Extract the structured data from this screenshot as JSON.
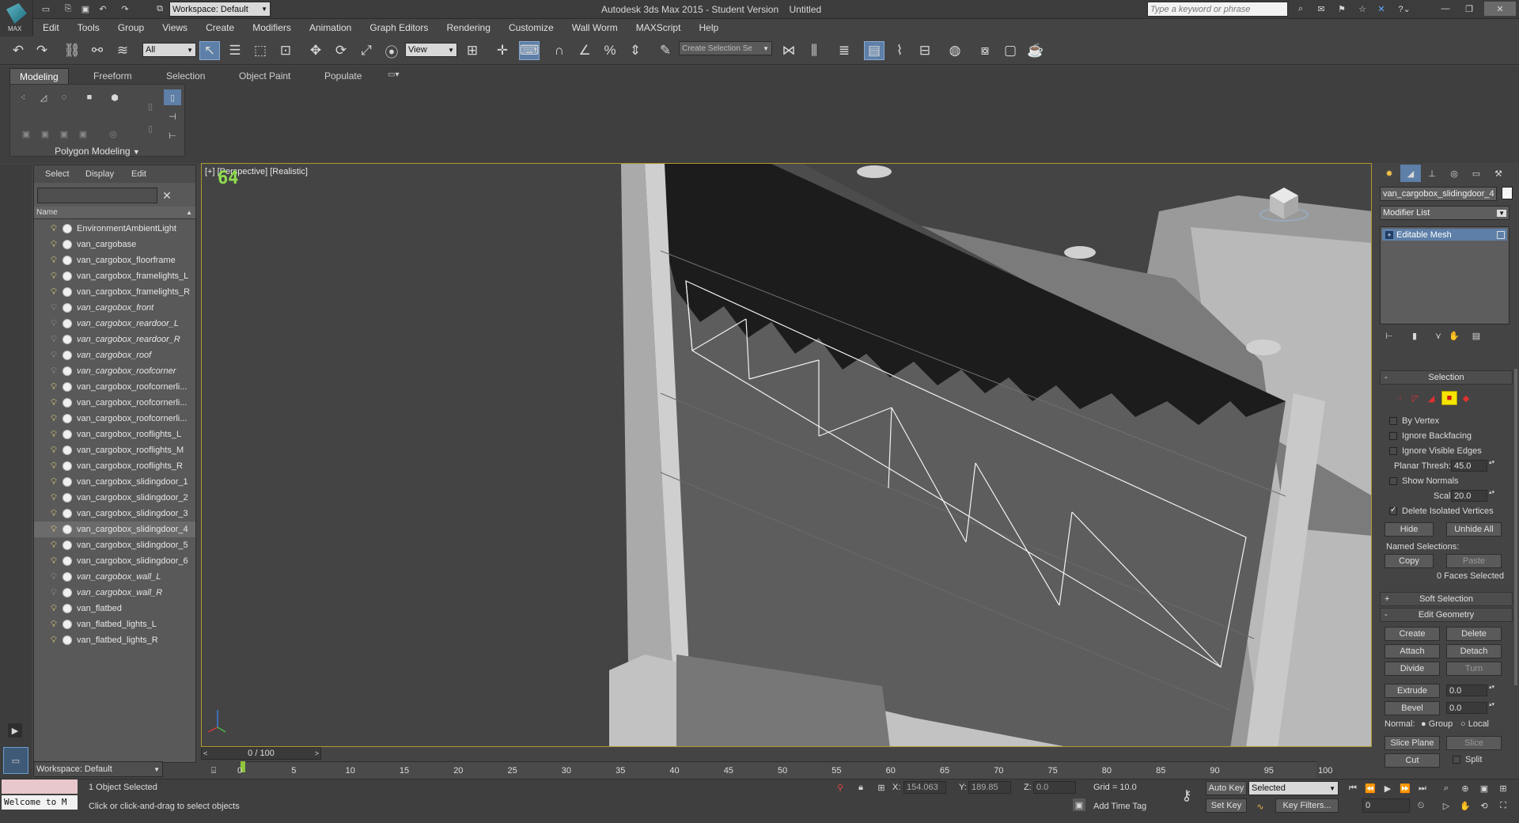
{
  "title_bar": {
    "app_logo": "MAX",
    "workspace": "Workspace: Default",
    "title": "Autodesk 3ds Max 2015 - Student Version    Untitled",
    "search_placeholder": "Type a keyword or phrase"
  },
  "menu": [
    "Edit",
    "Tools",
    "Group",
    "Views",
    "Create",
    "Modifiers",
    "Animation",
    "Graph Editors",
    "Rendering",
    "Customize",
    "Wall Worm",
    "MAXScript",
    "Help"
  ],
  "main_toolbar": {
    "selection_filter": "All",
    "reference_coord": "View",
    "named_selection_placeholder": "Create Selection Se"
  },
  "ribbon": {
    "tabs": [
      "Modeling",
      "Freeform",
      "Selection",
      "Object Paint",
      "Populate"
    ],
    "active_tab": "Modeling",
    "panel_label": "Polygon Modeling"
  },
  "scene_explorer": {
    "tabs": [
      "Select",
      "Display",
      "Edit"
    ],
    "column_header": "Name",
    "workspace": "Workspace: Default",
    "items": [
      {
        "name": "EnvironmentAmbientLight",
        "italic": false,
        "light_on": true,
        "selected": false
      },
      {
        "name": "van_cargobase",
        "italic": false,
        "light_on": true,
        "selected": false
      },
      {
        "name": "van_cargobox_floorframe",
        "italic": false,
        "light_on": true,
        "selected": false
      },
      {
        "name": "van_cargobox_framelights_L",
        "italic": false,
        "light_on": true,
        "selected": false
      },
      {
        "name": "van_cargobox_framelights_R",
        "italic": false,
        "light_on": true,
        "selected": false
      },
      {
        "name": "van_cargobox_front",
        "italic": true,
        "light_on": false,
        "selected": false
      },
      {
        "name": "van_cargobox_reardoor_L",
        "italic": true,
        "light_on": false,
        "selected": false
      },
      {
        "name": "van_cargobox_reardoor_R",
        "italic": true,
        "light_on": false,
        "selected": false
      },
      {
        "name": "van_cargobox_roof",
        "italic": true,
        "light_on": false,
        "selected": false
      },
      {
        "name": "van_cargobox_roofcorner",
        "italic": true,
        "light_on": false,
        "selected": false
      },
      {
        "name": "van_cargobox_roofcornerli...",
        "italic": false,
        "light_on": true,
        "selected": false
      },
      {
        "name": "van_cargobox_roofcornerli...",
        "italic": false,
        "light_on": true,
        "selected": false
      },
      {
        "name": "van_cargobox_roofcornerli...",
        "italic": false,
        "light_on": true,
        "selected": false
      },
      {
        "name": "van_cargobox_rooflights_L",
        "italic": false,
        "light_on": true,
        "selected": false
      },
      {
        "name": "van_cargobox_rooflights_M",
        "italic": false,
        "light_on": true,
        "selected": false
      },
      {
        "name": "van_cargobox_rooflights_R",
        "italic": false,
        "light_on": true,
        "selected": false
      },
      {
        "name": "van_cargobox_slidingdoor_1",
        "italic": false,
        "light_on": true,
        "selected": false
      },
      {
        "name": "van_cargobox_slidingdoor_2",
        "italic": false,
        "light_on": true,
        "selected": false
      },
      {
        "name": "van_cargobox_slidingdoor_3",
        "italic": false,
        "light_on": true,
        "selected": false
      },
      {
        "name": "van_cargobox_slidingdoor_4",
        "italic": false,
        "light_on": true,
        "selected": true
      },
      {
        "name": "van_cargobox_slidingdoor_5",
        "italic": false,
        "light_on": true,
        "selected": false
      },
      {
        "name": "van_cargobox_slidingdoor_6",
        "italic": false,
        "light_on": true,
        "selected": false
      },
      {
        "name": "van_cargobox_wall_L",
        "italic": true,
        "light_on": false,
        "selected": false
      },
      {
        "name": "van_cargobox_wall_R",
        "italic": true,
        "light_on": false,
        "selected": false
      },
      {
        "name": "van_flatbed",
        "italic": false,
        "light_on": true,
        "selected": false
      },
      {
        "name": "van_flatbed_lights_L",
        "italic": false,
        "light_on": true,
        "selected": false
      },
      {
        "name": "van_flatbed_lights_R",
        "italic": false,
        "light_on": true,
        "selected": false
      }
    ]
  },
  "viewport": {
    "label": "[+] [Perspective] [Realistic]",
    "fps": "64"
  },
  "command_panel": {
    "object_name": "van_cargobox_slidingdoor_4",
    "modifier_list": "Modifier List",
    "stack_item": "Editable Mesh",
    "selection": {
      "title": "Selection",
      "by_vertex": "By Vertex",
      "ignore_backfacing": "Ignore Backfacing",
      "ignore_visible_edges": "Ignore Visible Edges",
      "planar_thresh_label": "Planar Thresh:",
      "planar_thresh": "45.0",
      "show_normals": "Show Normals",
      "scale_label": "Scale:",
      "scale": "20.0",
      "delete_isolated": "Delete Isolated Vertices",
      "hide": "Hide",
      "unhide_all": "Unhide All",
      "named_selections": "Named Selections:",
      "copy": "Copy",
      "paste": "Paste",
      "status": "0 Faces Selected"
    },
    "soft_selection": "Soft Selection",
    "edit_geometry": {
      "title": "Edit Geometry",
      "create": "Create",
      "delete": "Delete",
      "attach": "Attach",
      "detach": "Detach",
      "divide": "Divide",
      "turn": "Turn",
      "extrude": "Extrude",
      "extrude_val": "0.0",
      "bevel": "Bevel",
      "bevel_val": "0.0",
      "normal_label": "Normal:",
      "group": "Group",
      "local": "Local",
      "slice_plane": "Slice Plane",
      "slice": "Slice",
      "cut": "Cut",
      "split": "Split"
    }
  },
  "timeline": {
    "frame_display": "0 / 100",
    "ticks": [
      "0",
      "5",
      "10",
      "15",
      "20",
      "25",
      "30",
      "35",
      "40",
      "45",
      "50",
      "55",
      "60",
      "65",
      "70",
      "75",
      "80",
      "85",
      "90",
      "95",
      "100"
    ]
  },
  "status": {
    "listener": "Welcome to M",
    "selected": "1 Object Selected",
    "prompt": "Click or click-and-drag to select objects",
    "x_label": "X:",
    "x": "154.063",
    "y_label": "Y:",
    "y": "189.85",
    "z_label": "Z:",
    "z": "0.0",
    "grid": "Grid = 10.0",
    "add_time_tag": "Add Time Tag",
    "auto_key": "Auto Key",
    "set_key": "Set Key",
    "key_mode": "Selected",
    "key_filters": "Key Filters...",
    "frame": "0"
  }
}
